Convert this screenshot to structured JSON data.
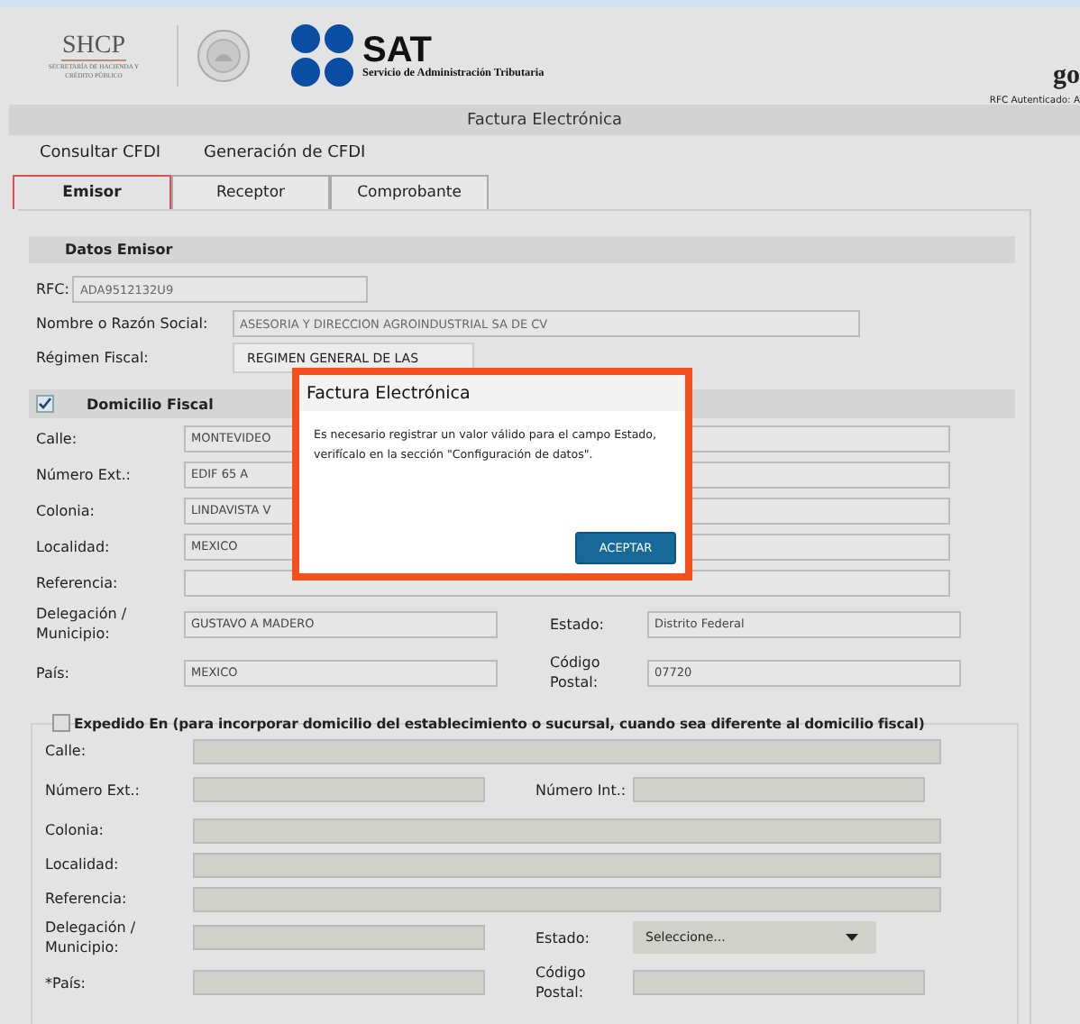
{
  "header": {
    "shcp_title": "SHCP",
    "shcp_subtitle": "SECRETARÍA DE HACIENDA Y CRÉDITO PÚBLICO",
    "sat_title": "SAT",
    "sat_subtitle": "Servicio de Administración Tributaria",
    "cut_text": "go"
  },
  "title_bar": {
    "title": "Factura Electrónica",
    "rfc_label": "RFC Autenticado: A"
  },
  "menu": [
    "Consultar CFDI",
    "Generación de CFDI"
  ],
  "tabs": [
    {
      "label": "Emisor",
      "selected": true
    },
    {
      "label": "Receptor",
      "selected": false
    },
    {
      "label": "Comprobante",
      "selected": false
    }
  ],
  "emisor": {
    "heading": "Datos Emisor",
    "rfc": {
      "label": "RFC:",
      "value": "ADA9512132U9"
    },
    "name": {
      "label": "Nombre o Razón Social:",
      "value": "ASESORIA Y DIRECCION AGROINDUSTRIAL SA DE CV"
    },
    "regime": {
      "label": "Régimen Fiscal:",
      "value": "REGIMEN GENERAL DE LAS"
    }
  },
  "domicilio": {
    "heading": "Domicilio Fiscal",
    "checked": true,
    "rows": [
      {
        "cells": [
          {
            "label": "Calle:",
            "kind": "input",
            "value": "MONTEVIDEO"
          }
        ]
      },
      {
        "cells": [
          {
            "label": "Número Ext.:",
            "kind": "input",
            "value": "EDIF 65 A"
          }
        ]
      },
      {
        "cells": [
          {
            "label": "Colonia:",
            "kind": "input",
            "value": "LINDAVISTA V"
          }
        ]
      },
      {
        "cells": [
          {
            "label": "Localidad:",
            "kind": "input",
            "value": "MEXICO"
          }
        ]
      },
      {
        "cells": [
          {
            "label": "Referencia:",
            "kind": "input"
          }
        ]
      },
      {
        "cells": [
          {
            "label": "Delegación / Municipio:",
            "kind": "input",
            "value": "GUSTAVO A MADERO"
          },
          {
            "label": "Estado:",
            "kind": "input",
            "value": "Distrito Federal"
          }
        ]
      },
      {
        "cells": [
          {
            "label": "País:",
            "kind": "input",
            "value": "MEXICO"
          },
          {
            "label": "Código Postal:",
            "kind": "input",
            "value": "07720"
          }
        ]
      }
    ]
  },
  "expedido": {
    "heading": "Expedido En (para incorporar domicilio del establecimiento o sucursal, cuando sea diferente al domicilio fiscal)",
    "checked": false,
    "rows": [
      {
        "cells": [
          {
            "label": "Calle:",
            "kind": "input"
          }
        ]
      },
      {
        "cells": [
          {
            "label": "Número Ext.:",
            "kind": "input"
          },
          {
            "label": "Número Int.:",
            "kind": "input"
          }
        ]
      },
      {
        "cells": [
          {
            "label": "Colonia:",
            "kind": "input"
          }
        ]
      },
      {
        "cells": [
          {
            "label": "Localidad:",
            "kind": "input"
          }
        ]
      },
      {
        "cells": [
          {
            "label": "Referencia:",
            "kind": "input"
          }
        ]
      },
      {
        "cells": [
          {
            "label": "Delegación / Municipio:",
            "kind": "input"
          },
          {
            "label": "Estado:",
            "kind": "select",
            "placeholder": "Seleccione..."
          }
        ]
      },
      {
        "cells": [
          {
            "label": "*País:",
            "kind": "input"
          },
          {
            "label": "Código Postal:",
            "kind": "input"
          }
        ]
      }
    ]
  },
  "modal": {
    "title": "Factura Electrónica",
    "message": "Es necesario registrar un valor válido para el campo Estado, verifícalo en la sección \"Configuración de datos\".",
    "button": "ACEPTAR"
  }
}
